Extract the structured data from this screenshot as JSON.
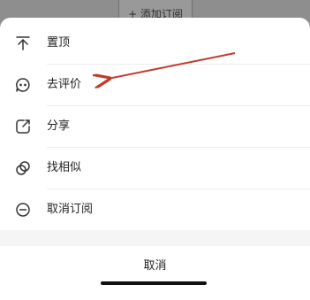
{
  "background": {
    "add_subscription_label": "+ 添加订阅"
  },
  "menu": {
    "items": [
      {
        "label": "置顶",
        "icon": "pin-top-icon"
      },
      {
        "label": "去评价",
        "icon": "comment-icon"
      },
      {
        "label": "分享",
        "icon": "share-icon"
      },
      {
        "label": "找相似",
        "icon": "find-similar-icon"
      },
      {
        "label": "取消订阅",
        "icon": "unsubscribe-icon"
      }
    ],
    "cancel_label": "取消"
  },
  "annotation": {
    "type": "red-arrow",
    "target": "去评价",
    "color": "#c0392b"
  }
}
